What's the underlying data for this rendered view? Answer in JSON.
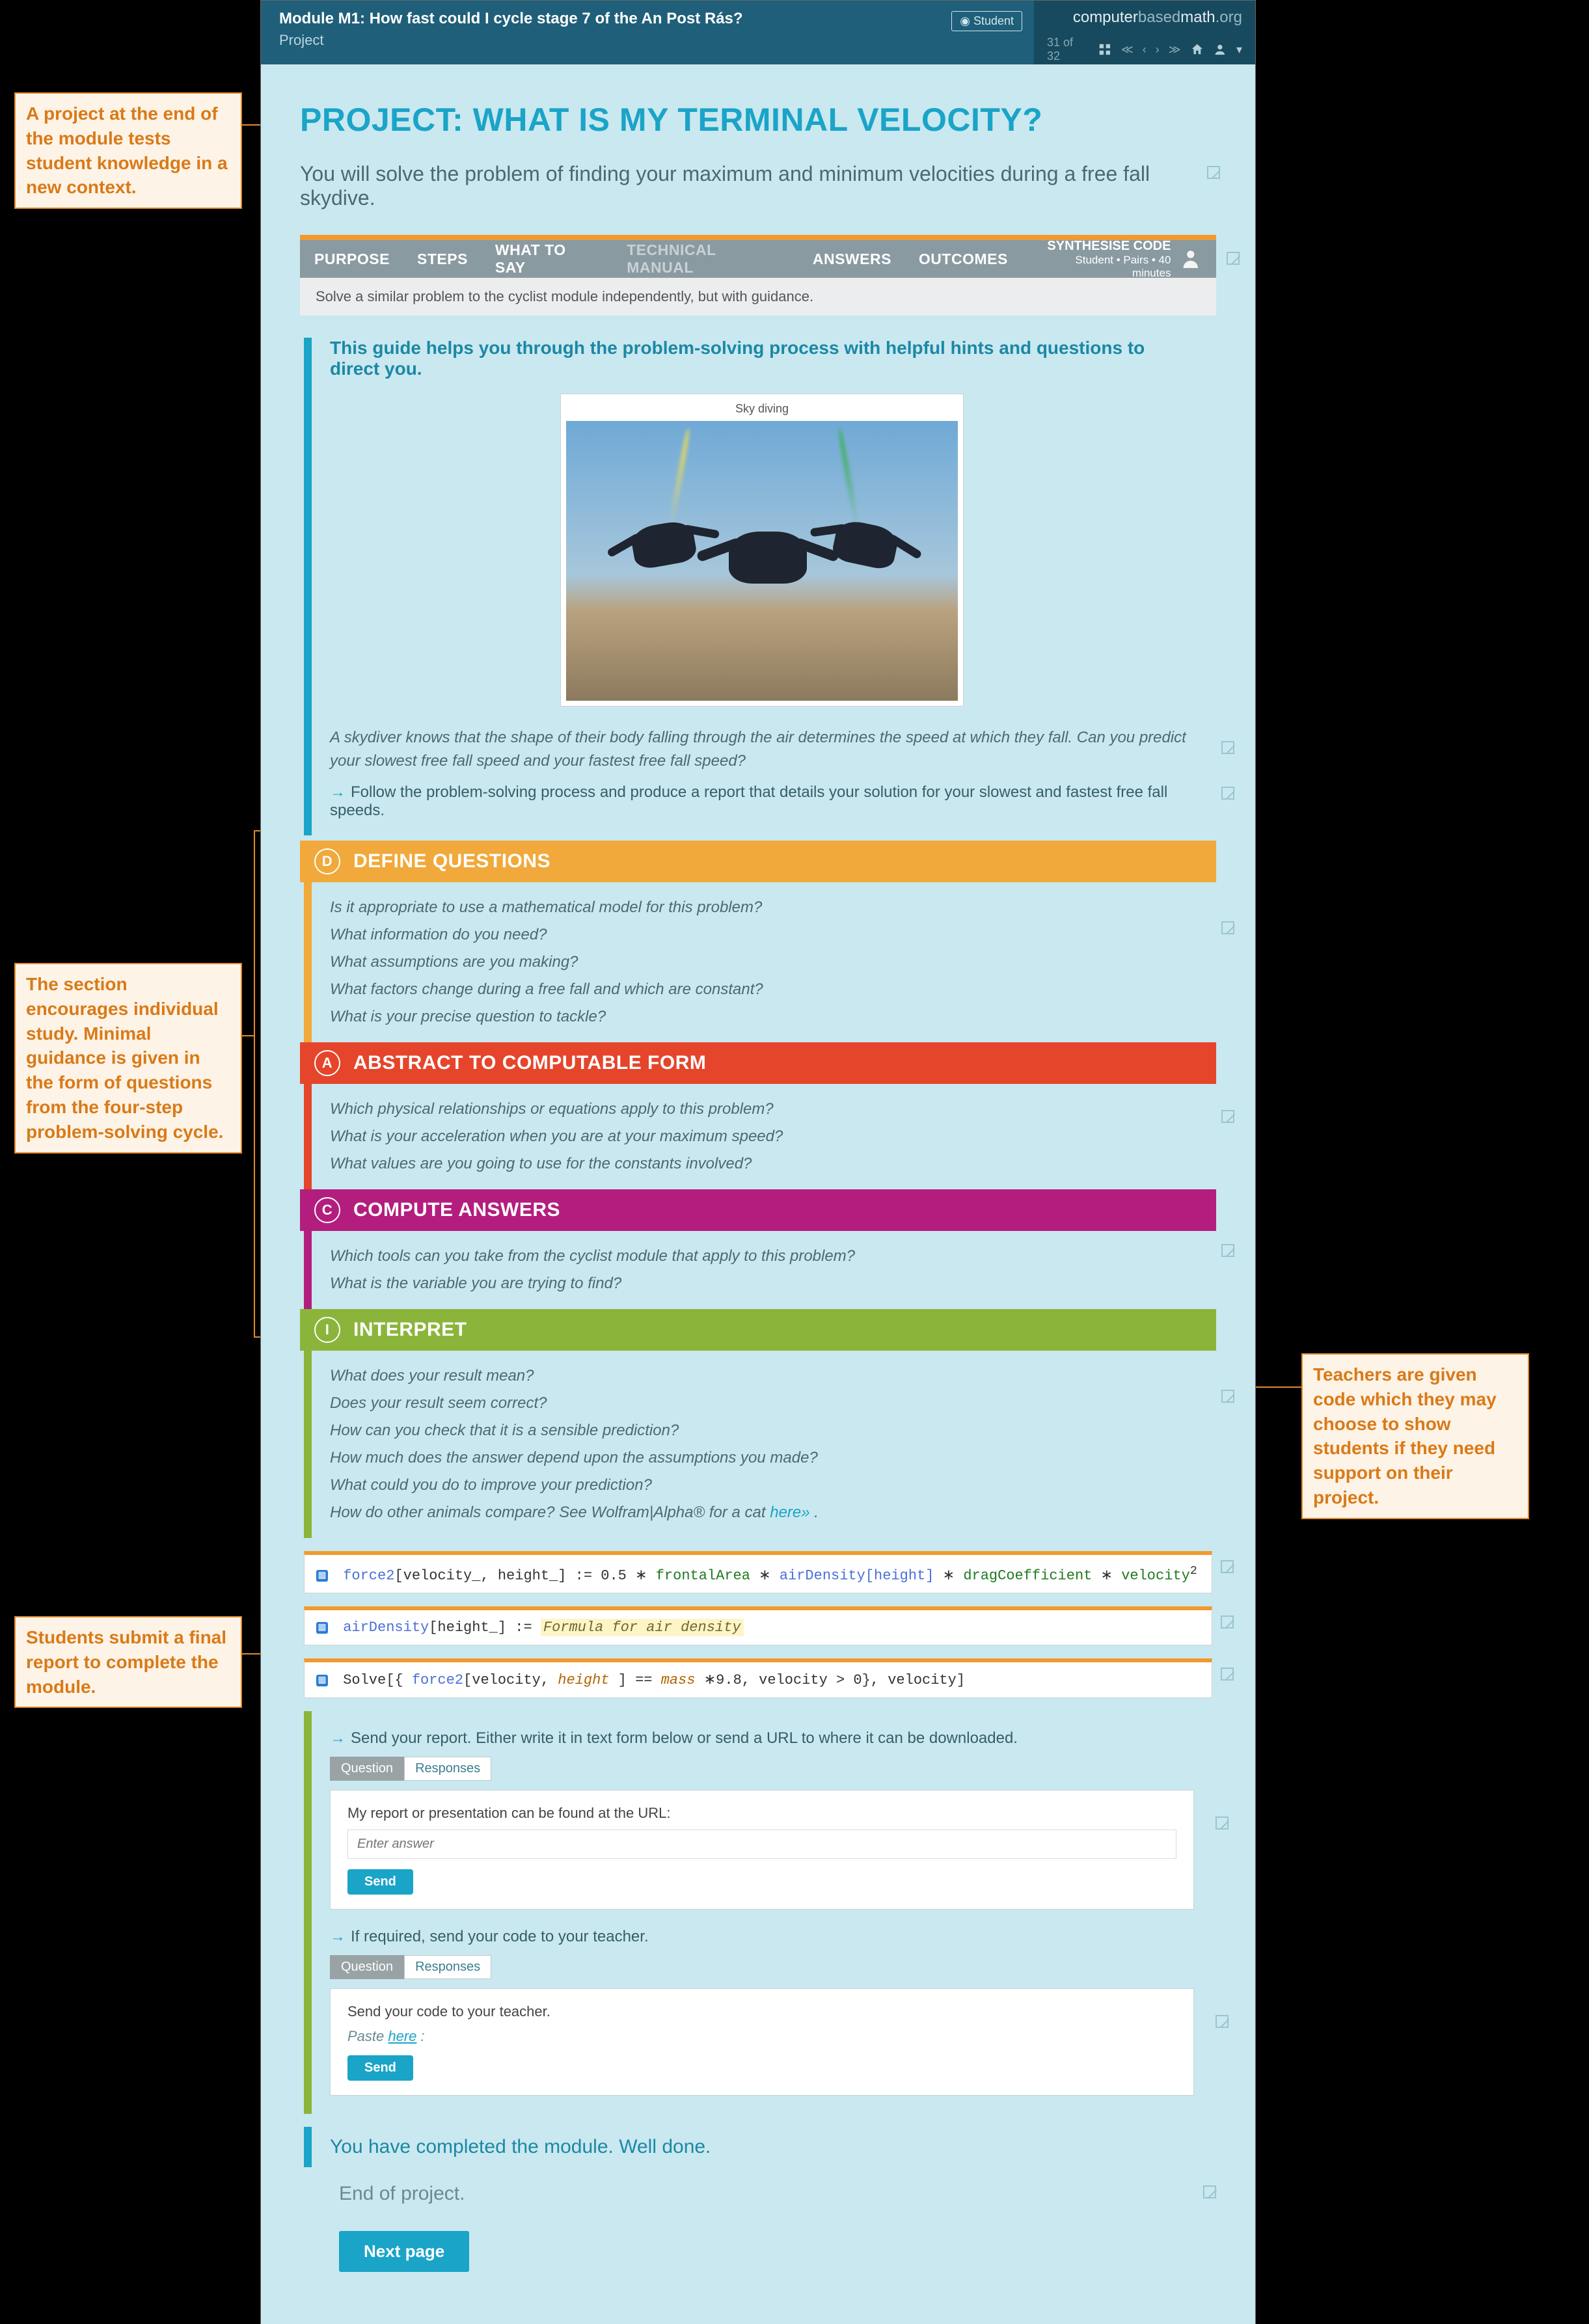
{
  "callouts": {
    "a": "A project at the end of the module tests student knowledge in a new context.",
    "b": "The section encourages individual study. Minimal guidance is given in the form of questions from the four-step problem-solving cycle.",
    "c": "Students submit a final report to complete the module.",
    "d": "Teachers are given code which they may choose to show students if they need support on their project."
  },
  "header": {
    "module_title": "Module M1: How fast could I cycle stage 7 of the An Post Rás?",
    "module_sub": "Project",
    "student_badge": "Student",
    "brand_a": "computer",
    "brand_b": "based",
    "brand_c": "math",
    "brand_d": ".org",
    "page_count": "31 of 32"
  },
  "page": {
    "title": "PROJECT: WHAT IS MY TERMINAL VELOCITY?",
    "lede": "You will solve the problem of finding your maximum and minimum velocities during a free fall skydive."
  },
  "tabs": {
    "items": [
      "PURPOSE",
      "STEPS",
      "WHAT TO SAY",
      "TECHNICAL MANUAL",
      "ANSWERS",
      "OUTCOMES"
    ],
    "right_title": "SYNTHESISE CODE",
    "right_sub": "Student  •  Pairs  •  40 minutes"
  },
  "graybar": "Solve a similar problem to the cyclist module independently, but with guidance.",
  "guide": {
    "heading": "This guide helps you through the problem-solving process with helpful hints and questions to direct you.",
    "image_caption": "Sky diving",
    "ital": "A skydiver knows that the shape of their body falling through the air determines the speed at which they fall. Can you predict your slowest free fall speed and your fastest free fall speed?",
    "arrow": "Follow the problem-solving process and produce a report that details your solution for your slowest and fastest free fall speeds."
  },
  "steps": {
    "d": {
      "letter": "D",
      "title": "DEFINE QUESTIONS",
      "q": [
        "Is it appropriate to use a mathematical model for this problem?",
        "What information do you need?",
        "What assumptions are you making?",
        "What factors change during a free fall and which are constant?",
        "What is your precise question to tackle?"
      ]
    },
    "a": {
      "letter": "A",
      "title": "ABSTRACT TO COMPUTABLE FORM",
      "q": [
        "Which physical relationships or equations apply to this problem?",
        "What is your acceleration when you are at your maximum speed?",
        "What values are you going to use for the constants involved?"
      ]
    },
    "c": {
      "letter": "C",
      "title": "COMPUTE ANSWERS",
      "q": [
        "Which tools can you take from the cyclist module that apply to this problem?",
        "What is the variable you are trying to find?"
      ]
    },
    "i": {
      "letter": "I",
      "title": "INTERPRET",
      "q": [
        "What does your result mean?",
        "Does your result seem correct?",
        "How can you check that it is a sensible prediction?",
        "How much does the answer depend upon the assumptions you made?",
        "What could you do to improve your prediction?"
      ],
      "q_last_pre": "How do other animals compare? See Wolfram|Alpha® for a cat ",
      "q_last_link": "here»",
      "q_last_post": " ."
    }
  },
  "code": {
    "c1_a": "force2",
    "c1_b": "[velocity_, height_]",
    "c1_c": ":= 0.5 ∗",
    "c1_d": "frontalArea",
    "c1_e": " ∗",
    "c1_f": "airDensity",
    "c1_g": "[height]",
    "c1_h": "∗",
    "c1_i": "dragCoefficient",
    "c1_j": "  ∗",
    "c1_k": "velocity",
    "c1_sup": "2",
    "c2_a": "airDensity",
    "c2_b": "[height_]",
    "c2_c": ":=",
    "c2_d": "Formula for air density",
    "c3_pre": "Solve",
    "c3_open": "[{",
    "c3_f": "force2",
    "c3_args": "[velocity, ",
    "c3_h": "height",
    "c3_mid": " ] == ",
    "c3_mass": "mass",
    "c3_rest": " ∗9.8, velocity > 0}, velocity]"
  },
  "report": {
    "line1": "Send your report. Either write it in text form below or send a URL to where it can be downloaded.",
    "pill_q": "Question",
    "pill_r": "Responses",
    "panel1_label": "My report or presentation can be found at the URL:",
    "panel1_placeholder": "Enter answer",
    "line2": "If required, send your code to your teacher.",
    "panel2_label": "Send your code to your teacher.",
    "panel2_pre": "Paste ",
    "panel2_link": "here",
    "panel2_post": " :",
    "send": "Send"
  },
  "done": "You have completed the module. Well done.",
  "end": "End of project.",
  "next": "Next page"
}
